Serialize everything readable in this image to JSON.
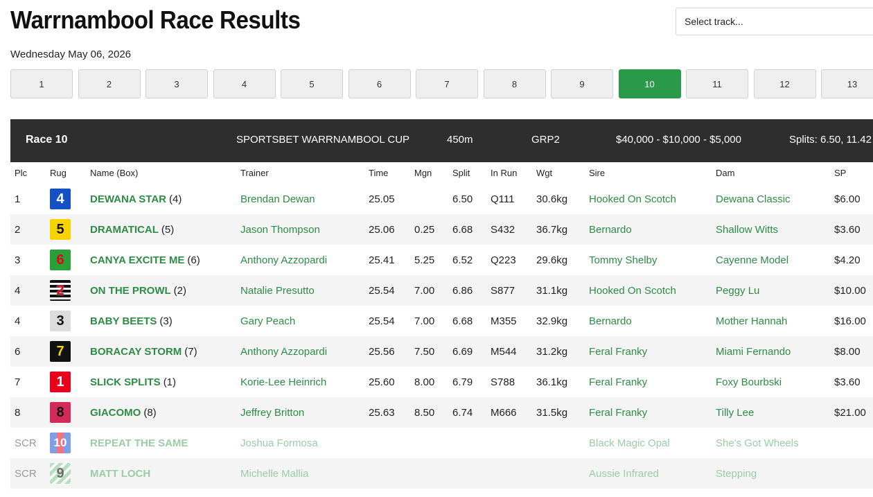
{
  "page": {
    "title": "Warrnambool Race Results",
    "date": "Wednesday May 06, 2026",
    "track_select_placeholder": "Select track..."
  },
  "race_tabs": [
    {
      "label": "1",
      "active": false
    },
    {
      "label": "2",
      "active": false
    },
    {
      "label": "3",
      "active": false
    },
    {
      "label": "4",
      "active": false
    },
    {
      "label": "5",
      "active": false
    },
    {
      "label": "6",
      "active": false
    },
    {
      "label": "7",
      "active": false
    },
    {
      "label": "8",
      "active": false
    },
    {
      "label": "9",
      "active": false
    },
    {
      "label": "10",
      "active": true
    },
    {
      "label": "11",
      "active": false
    },
    {
      "label": "12",
      "active": false
    },
    {
      "label": "13",
      "active": false
    }
  ],
  "race": {
    "number_label": "Race 10",
    "name": "SPORTSBET WARRNAMBOOL CUP",
    "distance": "450m",
    "grade": "GRP2",
    "prize": "$40,000 - $10,000 - $5,000",
    "splits": "Splits: 6.50, 11.42"
  },
  "columns": [
    "Plc",
    "Rug",
    "Name (Box)",
    "Trainer",
    "Time",
    "Mgn",
    "Split",
    "In Run",
    "Wgt",
    "Sire",
    "Dam",
    "SP"
  ],
  "results": [
    {
      "plc": "1",
      "rug": "4",
      "name": "DEWANA STAR",
      "box": "(4)",
      "trainer": "Brendan Dewan",
      "time": "25.05",
      "mgn": "",
      "split": "6.50",
      "in_run": "Q111",
      "wgt": "30.6kg",
      "sire": "Hooked On Scotch",
      "dam": "Dewana Classic",
      "sp": "$6.00"
    },
    {
      "plc": "2",
      "rug": "5",
      "name": "DRAMATICAL",
      "box": "(5)",
      "trainer": "Jason Thompson",
      "time": "25.06",
      "mgn": "0.25",
      "split": "6.68",
      "in_run": "S432",
      "wgt": "36.7kg",
      "sire": "Bernardo",
      "dam": "Shallow Witts",
      "sp": "$3.60"
    },
    {
      "plc": "3",
      "rug": "6",
      "name": "CANYA EXCITE ME",
      "box": "(6)",
      "trainer": "Anthony Azzopardi",
      "time": "25.41",
      "mgn": "5.25",
      "split": "6.52",
      "in_run": "Q223",
      "wgt": "29.6kg",
      "sire": "Tommy Shelby",
      "dam": "Cayenne Model",
      "sp": "$4.20"
    },
    {
      "plc": "4",
      "rug": "2",
      "name": "ON THE PROWL",
      "box": "(2)",
      "trainer": "Natalie Presutto",
      "time": "25.54",
      "mgn": "7.00",
      "split": "6.86",
      "in_run": "S877",
      "wgt": "31.1kg",
      "sire": "Hooked On Scotch",
      "dam": "Peggy Lu",
      "sp": "$10.00"
    },
    {
      "plc": "4",
      "rug": "3",
      "name": "BABY BEETS",
      "box": "(3)",
      "trainer": "Gary Peach",
      "time": "25.54",
      "mgn": "7.00",
      "split": "6.68",
      "in_run": "M355",
      "wgt": "32.9kg",
      "sire": "Bernardo",
      "dam": "Mother Hannah",
      "sp": "$16.00"
    },
    {
      "plc": "6",
      "rug": "7",
      "name": "BORACAY STORM",
      "box": "(7)",
      "trainer": "Anthony Azzopardi",
      "time": "25.56",
      "mgn": "7.50",
      "split": "6.69",
      "in_run": "M544",
      "wgt": "31.2kg",
      "sire": "Feral Franky",
      "dam": "Miami Fernando",
      "sp": "$8.00"
    },
    {
      "plc": "7",
      "rug": "1",
      "name": "SLICK SPLITS",
      "box": "(1)",
      "trainer": "Korie-Lee Heinrich",
      "time": "25.60",
      "mgn": "8.00",
      "split": "6.79",
      "in_run": "S788",
      "wgt": "36.1kg",
      "sire": "Feral Franky",
      "dam": "Foxy Bourbski",
      "sp": "$3.60"
    },
    {
      "plc": "8",
      "rug": "8",
      "name": "GIACOMO",
      "box": "(8)",
      "trainer": "Jeffrey Britton",
      "time": "25.63",
      "mgn": "8.50",
      "split": "6.74",
      "in_run": "M666",
      "wgt": "31.5kg",
      "sire": "Feral Franky",
      "dam": "Tilly Lee",
      "sp": "$21.00"
    },
    {
      "plc": "SCR",
      "rug": "10",
      "name": "REPEAT THE SAME",
      "box": "",
      "trainer": "Joshua Formosa",
      "time": "",
      "mgn": "",
      "split": "",
      "in_run": "",
      "wgt": "",
      "sire": "Black Magic Opal",
      "dam": "She's Got Wheels",
      "sp": ""
    },
    {
      "plc": "SCR",
      "rug": "9",
      "name": "MATT LOCH",
      "box": "",
      "trainer": "Michelle Mallia",
      "time": "",
      "mgn": "",
      "split": "",
      "in_run": "",
      "wgt": "",
      "sire": "Aussie Infrared",
      "dam": "Stepping",
      "sp": ""
    }
  ]
}
